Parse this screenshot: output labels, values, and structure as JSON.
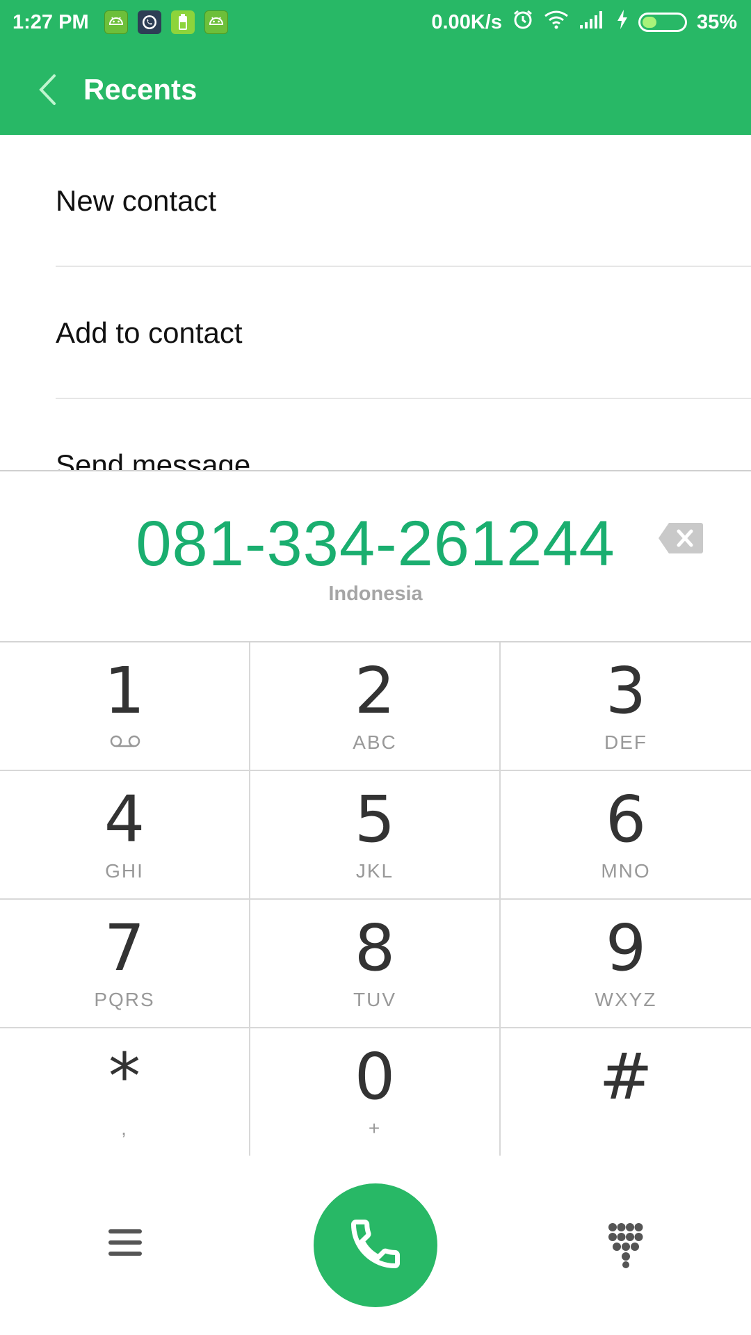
{
  "status_bar": {
    "time": "1:27 PM",
    "net_speed": "0.00K/s",
    "battery_percent": "35%",
    "battery_level": 0.35,
    "notification_icons": [
      "android-icon",
      "whatsapp-icon",
      "battery-app-icon",
      "android-icon"
    ],
    "status_icons": [
      "alarm-icon",
      "wifi-icon",
      "signal-icon",
      "charging-icon",
      "battery-icon"
    ]
  },
  "header": {
    "title": "Recents",
    "back_icon": "back-arrow-icon"
  },
  "options": [
    {
      "label": "New contact"
    },
    {
      "label": "Add to contact"
    },
    {
      "label": "Send message"
    }
  ],
  "dialer": {
    "number": "081-334-261244",
    "region": "Indonesia",
    "backspace_icon": "backspace-icon"
  },
  "keypad": [
    {
      "digit": "1",
      "letters": "",
      "icon": "voicemail-icon"
    },
    {
      "digit": "2",
      "letters": "ABC"
    },
    {
      "digit": "3",
      "letters": "DEF"
    },
    {
      "digit": "4",
      "letters": "GHI"
    },
    {
      "digit": "5",
      "letters": "JKL"
    },
    {
      "digit": "6",
      "letters": "MNO"
    },
    {
      "digit": "7",
      "letters": "PQRS"
    },
    {
      "digit": "8",
      "letters": "TUV"
    },
    {
      "digit": "9",
      "letters": "WXYZ"
    },
    {
      "digit": "*",
      "letters": ","
    },
    {
      "digit": "0",
      "letters": "+"
    },
    {
      "digit": "#",
      "letters": ""
    }
  ],
  "bottom_bar": {
    "menu_icon": "menu-icon",
    "call_icon": "phone-icon",
    "dialpad_icon": "dialpad-icon"
  },
  "colors": {
    "accent": "#28b866",
    "number_color": "#1aae6f"
  }
}
